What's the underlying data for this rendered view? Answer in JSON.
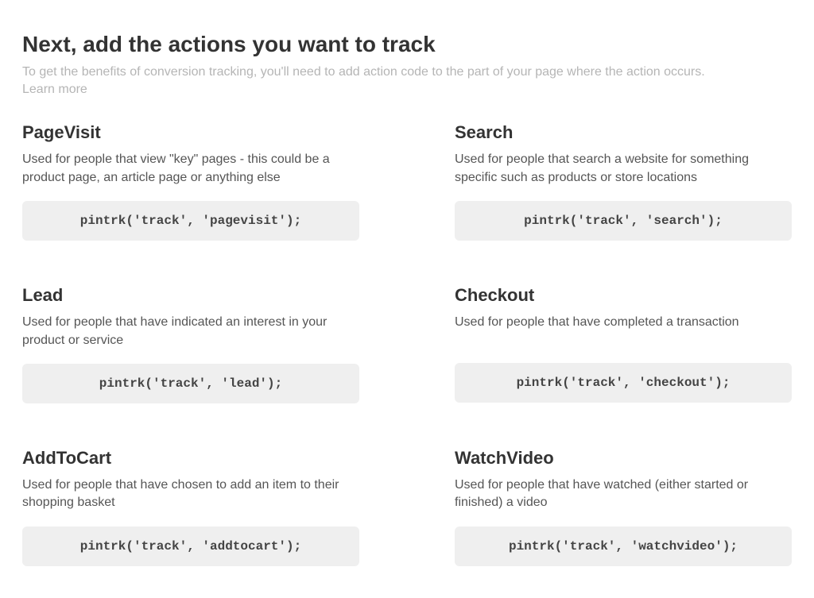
{
  "header": {
    "title": "Next, add the actions you want to track",
    "subtitle": "To get the benefits of conversion tracking, you'll need to add action code to the part of your page where the action occurs.",
    "learn_more": "Learn more"
  },
  "actions": [
    {
      "title": "PageVisit",
      "description": "Used for people that view \"key\" pages - this could be a product page, an article page or anything else",
      "code": "pintrk('track', 'pagevisit');"
    },
    {
      "title": "Search",
      "description": "Used for people that search a website for something specific such as products or store locations",
      "code": "pintrk('track', 'search');"
    },
    {
      "title": "Lead",
      "description": "Used for people that have indicated an interest in your product or service",
      "code": "pintrk('track', 'lead');"
    },
    {
      "title": "Checkout",
      "description": "Used for people that have completed a transaction",
      "code": "pintrk('track', 'checkout');"
    },
    {
      "title": "AddToCart",
      "description": "Used for people that have chosen to add an item to their shopping basket",
      "code": "pintrk('track', 'addtocart');"
    },
    {
      "title": "WatchVideo",
      "description": "Used for people that have watched (either started or finished) a video",
      "code": "pintrk('track', 'watchvideo');"
    }
  ]
}
